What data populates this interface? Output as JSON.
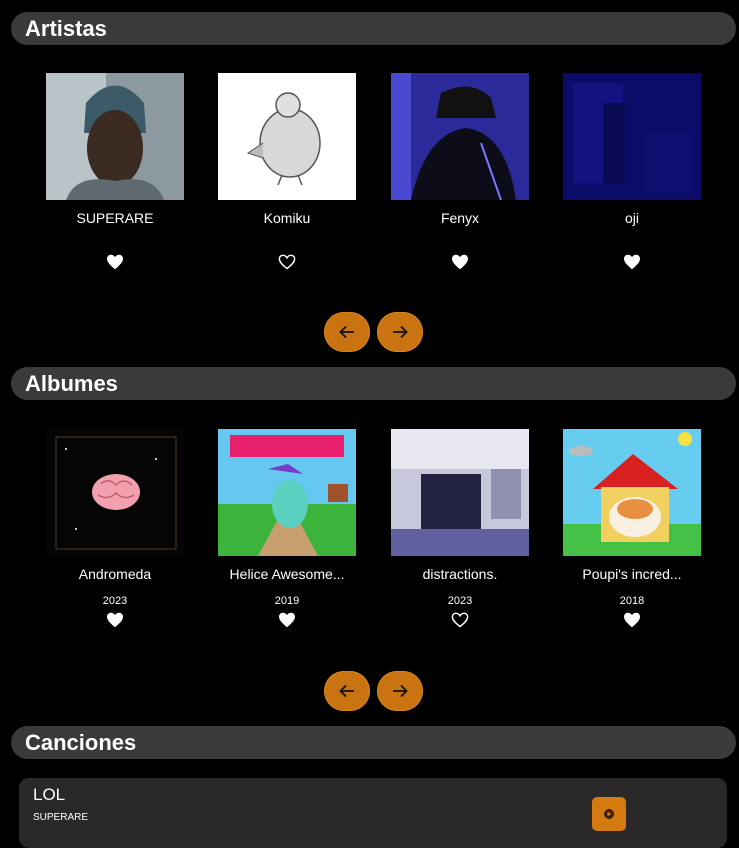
{
  "artists": {
    "title": "Artistas",
    "items": [
      {
        "name": "SUPERARE",
        "liked": true
      },
      {
        "name": "Komiku",
        "liked": false
      },
      {
        "name": "Fenyx",
        "liked": true
      },
      {
        "name": "oji",
        "liked": true
      }
    ]
  },
  "albums": {
    "title": "Albumes",
    "items": [
      {
        "name": "Andromeda",
        "year": "2023",
        "liked": true
      },
      {
        "name": "Helice Awesome...",
        "year": "2019",
        "liked": true
      },
      {
        "name": "distractions.",
        "year": "2023",
        "liked": false
      },
      {
        "name": "Poupi's incred...",
        "year": "2018",
        "liked": true
      }
    ]
  },
  "songs": {
    "title": "Canciones",
    "items": [
      {
        "title": "LOL",
        "artist": "SUPERARE"
      }
    ]
  },
  "icons": {
    "prev": "arrow-left-icon",
    "next": "arrow-right-icon",
    "heart_filled": "heart-filled-icon",
    "heart_outline": "heart-outline-icon",
    "play": "play-icon"
  },
  "colors": {
    "accent": "#c97411",
    "header_bg": "#3a3a3a",
    "song_bg": "#2a2828"
  }
}
